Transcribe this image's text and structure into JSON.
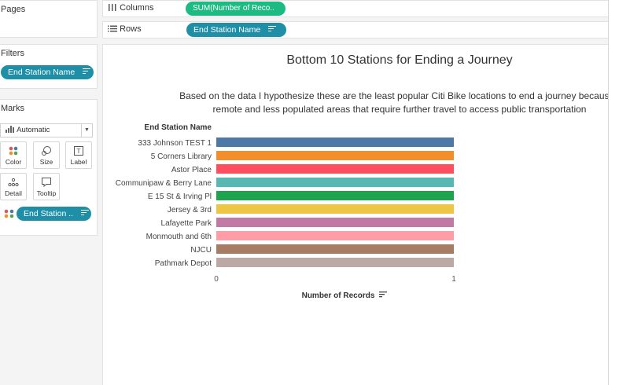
{
  "left_panel": {
    "pages_title": "Pages",
    "filters_title": "Filters",
    "filter_pill": "End Station Name",
    "marks_title": "Marks",
    "mark_type": "Automatic",
    "mark_buttons": {
      "color": "Color",
      "size": "Size",
      "label": "Label",
      "detail": "Detail",
      "tooltip": "Tooltip"
    },
    "color_pill": "End Station .."
  },
  "shelves": {
    "columns_label": "Columns",
    "columns_pill": "SUM(Number of Reco..",
    "rows_label": "Rows",
    "rows_pill": "End Station Name"
  },
  "chart_data": {
    "type": "bar",
    "title": "Bottom 10 Stations for Ending a Journey",
    "caption_line1": "Based on the data I hypothesize these are the least popular Citi Bike locations to end a journey because t",
    "caption_line2": "remote and less populated areas that require further travel to access public transportation",
    "ylabel": "End Station Name",
    "xlabel": "Number of Records",
    "categories": [
      "333 Johnson TEST 1",
      "5 Corners Library",
      "Astor Place",
      "Communipaw & Berry Lane",
      "E 15 St & Irving Pl",
      "Jersey & 3rd",
      "Lafayette Park",
      "Monmouth and 6th",
      "NJCU",
      "Pathmark Depot"
    ],
    "values": [
      1,
      1,
      1,
      1,
      1,
      1,
      1,
      1,
      1,
      1
    ],
    "colors": [
      "#4e79a7",
      "#f28e2b",
      "#ff4f5e",
      "#59b8b2",
      "#1ea44d",
      "#eec646",
      "#c17aa4",
      "#ff9da7",
      "#a87c63",
      "#baa9a4"
    ],
    "xlim": [
      0,
      1
    ],
    "xticks": [
      "0",
      "1"
    ]
  }
}
